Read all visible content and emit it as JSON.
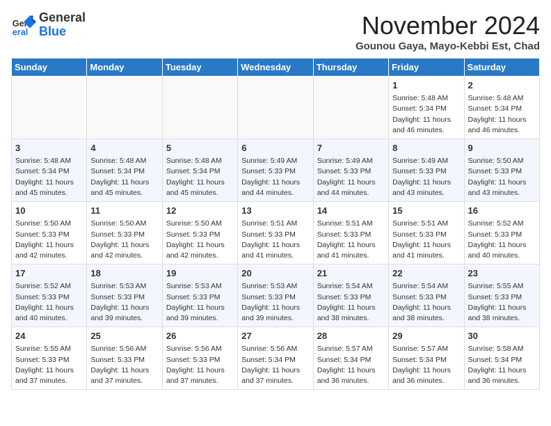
{
  "header": {
    "logo_general": "General",
    "logo_blue": "Blue",
    "month_title": "November 2024",
    "subtitle": "Gounou Gaya, Mayo-Kebbi Est, Chad"
  },
  "weekdays": [
    "Sunday",
    "Monday",
    "Tuesday",
    "Wednesday",
    "Thursday",
    "Friday",
    "Saturday"
  ],
  "weeks": [
    [
      {
        "day": "",
        "info": ""
      },
      {
        "day": "",
        "info": ""
      },
      {
        "day": "",
        "info": ""
      },
      {
        "day": "",
        "info": ""
      },
      {
        "day": "",
        "info": ""
      },
      {
        "day": "1",
        "info": "Sunrise: 5:48 AM\nSunset: 5:34 PM\nDaylight: 11 hours\nand 46 minutes."
      },
      {
        "day": "2",
        "info": "Sunrise: 5:48 AM\nSunset: 5:34 PM\nDaylight: 11 hours\nand 46 minutes."
      }
    ],
    [
      {
        "day": "3",
        "info": "Sunrise: 5:48 AM\nSunset: 5:34 PM\nDaylight: 11 hours\nand 45 minutes."
      },
      {
        "day": "4",
        "info": "Sunrise: 5:48 AM\nSunset: 5:34 PM\nDaylight: 11 hours\nand 45 minutes."
      },
      {
        "day": "5",
        "info": "Sunrise: 5:48 AM\nSunset: 5:34 PM\nDaylight: 11 hours\nand 45 minutes."
      },
      {
        "day": "6",
        "info": "Sunrise: 5:49 AM\nSunset: 5:33 PM\nDaylight: 11 hours\nand 44 minutes."
      },
      {
        "day": "7",
        "info": "Sunrise: 5:49 AM\nSunset: 5:33 PM\nDaylight: 11 hours\nand 44 minutes."
      },
      {
        "day": "8",
        "info": "Sunrise: 5:49 AM\nSunset: 5:33 PM\nDaylight: 11 hours\nand 43 minutes."
      },
      {
        "day": "9",
        "info": "Sunrise: 5:50 AM\nSunset: 5:33 PM\nDaylight: 11 hours\nand 43 minutes."
      }
    ],
    [
      {
        "day": "10",
        "info": "Sunrise: 5:50 AM\nSunset: 5:33 PM\nDaylight: 11 hours\nand 42 minutes."
      },
      {
        "day": "11",
        "info": "Sunrise: 5:50 AM\nSunset: 5:33 PM\nDaylight: 11 hours\nand 42 minutes."
      },
      {
        "day": "12",
        "info": "Sunrise: 5:50 AM\nSunset: 5:33 PM\nDaylight: 11 hours\nand 42 minutes."
      },
      {
        "day": "13",
        "info": "Sunrise: 5:51 AM\nSunset: 5:33 PM\nDaylight: 11 hours\nand 41 minutes."
      },
      {
        "day": "14",
        "info": "Sunrise: 5:51 AM\nSunset: 5:33 PM\nDaylight: 11 hours\nand 41 minutes."
      },
      {
        "day": "15",
        "info": "Sunrise: 5:51 AM\nSunset: 5:33 PM\nDaylight: 11 hours\nand 41 minutes."
      },
      {
        "day": "16",
        "info": "Sunrise: 5:52 AM\nSunset: 5:33 PM\nDaylight: 11 hours\nand 40 minutes."
      }
    ],
    [
      {
        "day": "17",
        "info": "Sunrise: 5:52 AM\nSunset: 5:33 PM\nDaylight: 11 hours\nand 40 minutes."
      },
      {
        "day": "18",
        "info": "Sunrise: 5:53 AM\nSunset: 5:33 PM\nDaylight: 11 hours\nand 39 minutes."
      },
      {
        "day": "19",
        "info": "Sunrise: 5:53 AM\nSunset: 5:33 PM\nDaylight: 11 hours\nand 39 minutes."
      },
      {
        "day": "20",
        "info": "Sunrise: 5:53 AM\nSunset: 5:33 PM\nDaylight: 11 hours\nand 39 minutes."
      },
      {
        "day": "21",
        "info": "Sunrise: 5:54 AM\nSunset: 5:33 PM\nDaylight: 11 hours\nand 38 minutes."
      },
      {
        "day": "22",
        "info": "Sunrise: 5:54 AM\nSunset: 5:33 PM\nDaylight: 11 hours\nand 38 minutes."
      },
      {
        "day": "23",
        "info": "Sunrise: 5:55 AM\nSunset: 5:33 PM\nDaylight: 11 hours\nand 38 minutes."
      }
    ],
    [
      {
        "day": "24",
        "info": "Sunrise: 5:55 AM\nSunset: 5:33 PM\nDaylight: 11 hours\nand 37 minutes."
      },
      {
        "day": "25",
        "info": "Sunrise: 5:56 AM\nSunset: 5:33 PM\nDaylight: 11 hours\nand 37 minutes."
      },
      {
        "day": "26",
        "info": "Sunrise: 5:56 AM\nSunset: 5:33 PM\nDaylight: 11 hours\nand 37 minutes."
      },
      {
        "day": "27",
        "info": "Sunrise: 5:56 AM\nSunset: 5:34 PM\nDaylight: 11 hours\nand 37 minutes."
      },
      {
        "day": "28",
        "info": "Sunrise: 5:57 AM\nSunset: 5:34 PM\nDaylight: 11 hours\nand 36 minutes."
      },
      {
        "day": "29",
        "info": "Sunrise: 5:57 AM\nSunset: 5:34 PM\nDaylight: 11 hours\nand 36 minutes."
      },
      {
        "day": "30",
        "info": "Sunrise: 5:58 AM\nSunset: 5:34 PM\nDaylight: 11 hours\nand 36 minutes."
      }
    ]
  ]
}
